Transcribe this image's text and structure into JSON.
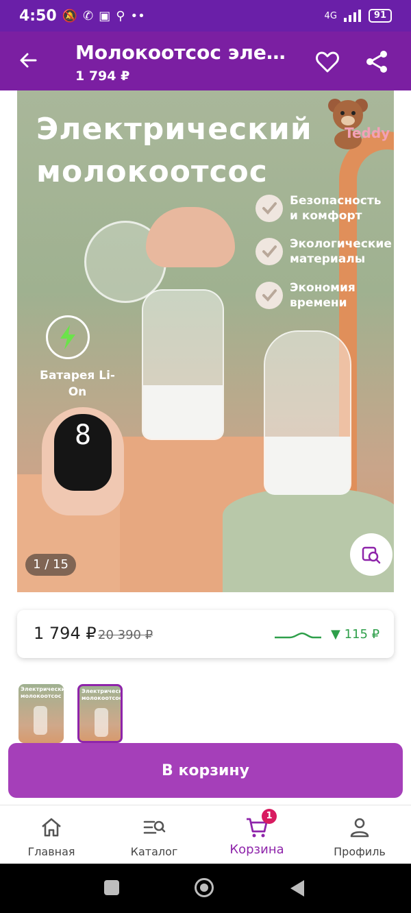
{
  "status_bar": {
    "time": "4:50",
    "network": "4G",
    "battery": "91"
  },
  "app_bar": {
    "title": "Молокоотсос электрический",
    "price": "1 794 ₽"
  },
  "gallery": {
    "image_title_line1": "Электрический",
    "image_title_line2": "молокоотсос",
    "brand": "Teddy",
    "features": [
      "Безопасность и комфорт",
      "Экологические материалы",
      "Экономия времени"
    ],
    "battery_label": "Батарея Li-On",
    "device_display": "8",
    "counter": "1 / 15"
  },
  "price_card": {
    "price": "1 794 ₽",
    "old_price": "20 390 ₽",
    "change": "▼ 115 ₽"
  },
  "thumbnails": {
    "title": "Электрический молокоотсос"
  },
  "cart_button": {
    "label": "В корзину"
  },
  "bottom_nav": {
    "items": [
      {
        "label": "Главная",
        "icon": "home-icon"
      },
      {
        "label": "Каталог",
        "icon": "catalog-icon"
      },
      {
        "label": "Корзина",
        "icon": "cart-icon"
      },
      {
        "label": "Профиль",
        "icon": "profile-icon"
      }
    ],
    "cart_badge": "1"
  },
  "colors": {
    "brand": "#7b1fa2",
    "button": "#a53fb9",
    "accent": "#8e24aa",
    "price_drop": "#2e9f4a",
    "badge": "#d81b60"
  }
}
